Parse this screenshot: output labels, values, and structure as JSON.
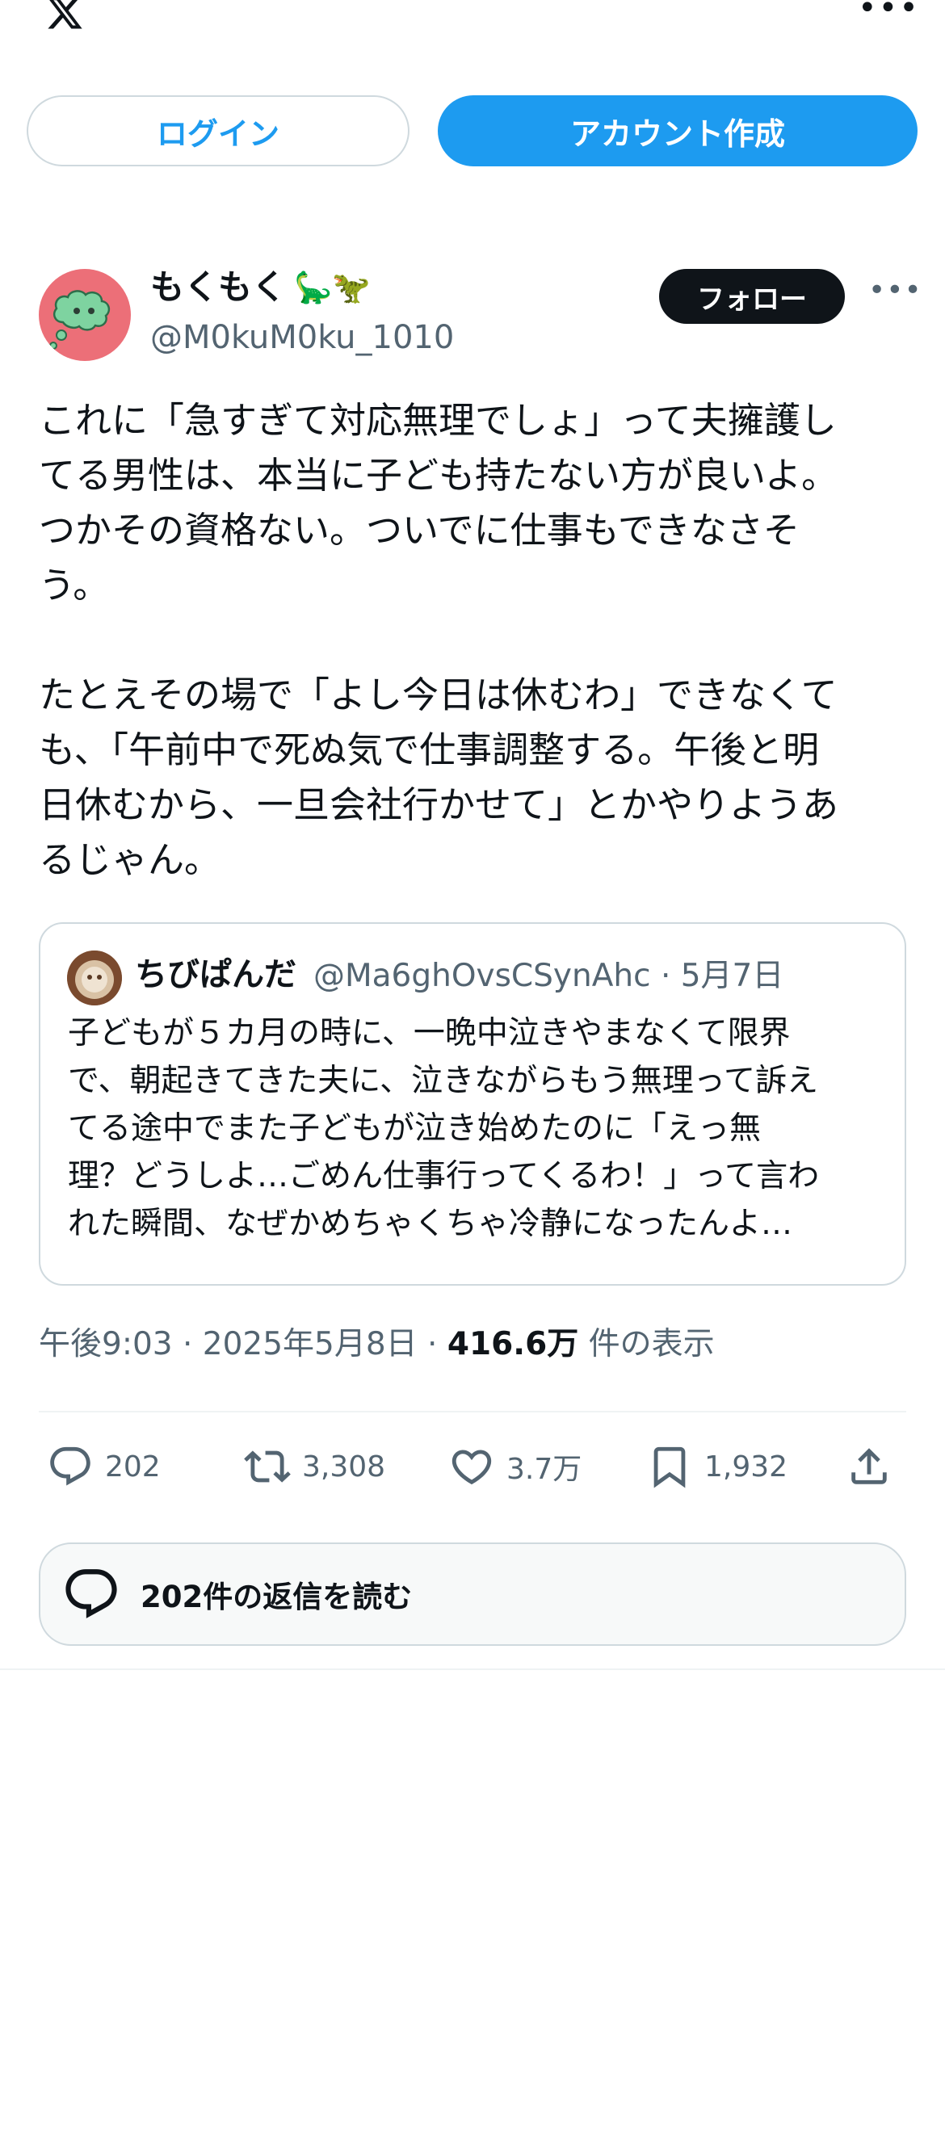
{
  "top": {
    "login_label": "ログイン",
    "signup_label": "アカウント作成"
  },
  "post": {
    "author_name": "もくもく",
    "author_emoji": "🦕🦖",
    "handle": "@M0kuM0ku_1010",
    "follow_label": "フォロー",
    "text": "これに「急すぎて対応無理でしょ」って夫擁護し\nてる男性は、本当に子ども持たない方が良いよ。\nつかその資格ない。ついでに仕事もできなさそ\nう。\n\nたとえその場で「よし今日は休むわ」できなくて\nも、「午前中で死ぬ気で仕事調整する。午後と明\n日休むから、一旦会社行かせて」とかやりようあ\nるじゃん。",
    "time": "午後9:03 · 2025年5月8日 · ",
    "views_count": "416.6万",
    "views_label": " 件の表示"
  },
  "quote": {
    "author_name": "ちびぱんだ",
    "meta": "@Ma6ghOvsCSynAhc · 5月7日",
    "text": "子どもが５カ月の時に、一晩中泣きやまなくて限界\nで、朝起きてきた夫に、泣きながらもう無理って訴え\nてる途中でまた子どもが泣き始めたのに「えっ無\n理？どうしよ…ごめん仕事行ってくるわ！」って言わ\nれた瞬間、なぜかめちゃくちゃ冷静になったんよ…"
  },
  "actions": {
    "replies": "202",
    "reposts": "3,308",
    "likes": "3.7万",
    "bookmarks": "1,932"
  },
  "read_replies_label": "202件の返信を読む",
  "colors": {
    "accent": "#1d9bf0",
    "text_primary": "#0f1419",
    "text_secondary": "#536471",
    "border": "#cfd9de",
    "avatar_bg": "#ec6f78"
  },
  "icons": {
    "brand": "x-logo-icon",
    "more": "more-icon",
    "reply": "reply-icon",
    "repost": "repost-icon",
    "like": "heart-icon",
    "bookmark": "bookmark-icon",
    "share": "share-icon",
    "replies_bar": "chat-bubble-icon"
  }
}
